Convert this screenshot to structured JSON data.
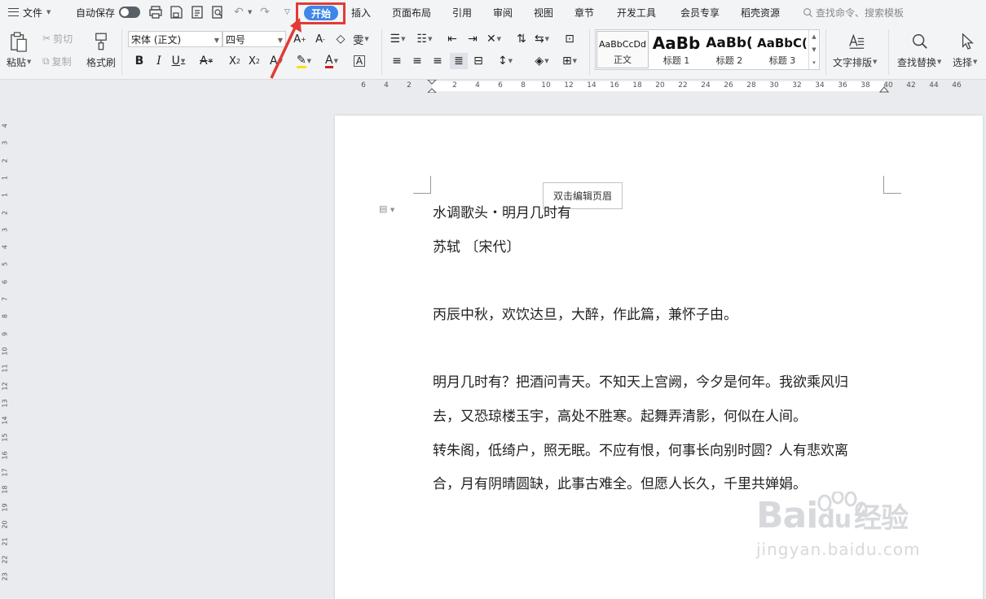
{
  "menubar": {
    "file": "文件",
    "autosave": "自动保存",
    "tabs": [
      "开始",
      "插入",
      "页面布局",
      "引用",
      "审阅",
      "视图",
      "章节",
      "开发工具",
      "会员专享",
      "稻壳资源"
    ],
    "search": "查找命令、搜索模板"
  },
  "ribbon": {
    "paste": "粘贴",
    "cut": "剪切",
    "copy": "复制",
    "format_painter": "格式刷",
    "font_name": "宋体 (正文)",
    "font_size": "四号",
    "styles": [
      {
        "sample": "AaBbCcDd",
        "label": "正文"
      },
      {
        "sample": "AaBb",
        "label": "标题 1"
      },
      {
        "sample": "AaBb(",
        "label": "标题 2"
      },
      {
        "sample": "AaBbC(",
        "label": "标题 3"
      }
    ],
    "text_layout": "文字排版",
    "find_replace": "查找替换",
    "select": "选择"
  },
  "ruler": {
    "h_ticks": [
      "6",
      "4",
      "2",
      "2",
      "4",
      "6",
      "8",
      "10",
      "12",
      "14",
      "16",
      "18",
      "20",
      "22",
      "24",
      "26",
      "28",
      "30",
      "32",
      "34",
      "36",
      "38",
      "40",
      "42",
      "44",
      "46"
    ],
    "v_ticks": [
      "4",
      "3",
      "2",
      "1",
      "1",
      "2",
      "3",
      "4",
      "5",
      "6",
      "7",
      "8",
      "9",
      "10",
      "11",
      "12",
      "13",
      "14",
      "15",
      "16",
      "17",
      "18",
      "19",
      "20",
      "21",
      "22",
      "23"
    ]
  },
  "document": {
    "header_tip": "双击编辑页眉",
    "lines": [
      "水调歌头・明月几时有",
      "苏轼 〔宋代〕",
      "丙辰中秋，欢饮达旦，大醉，作此篇，兼怀子由。",
      "明月几时有？把酒问青天。不知天上宫阙，今夕是何年。我欲乘风归",
      "去，又恐琼楼玉宇，高处不胜寒。起舞弄清影，何似在人间。",
      "转朱阁，低绮户，照无眠。不应有恨，何事长向别时圆？人有悲欢离",
      "合，月有阴晴圆缺，此事古难全。但愿人长久，千里共婵娟。"
    ]
  },
  "watermark": {
    "brand": "Bai",
    "brand2": "du",
    "cn": "经验",
    "url": "jingyan.baidu.com"
  },
  "colors": {
    "accent": "#3e86e8",
    "highlight": "#e23b34"
  }
}
